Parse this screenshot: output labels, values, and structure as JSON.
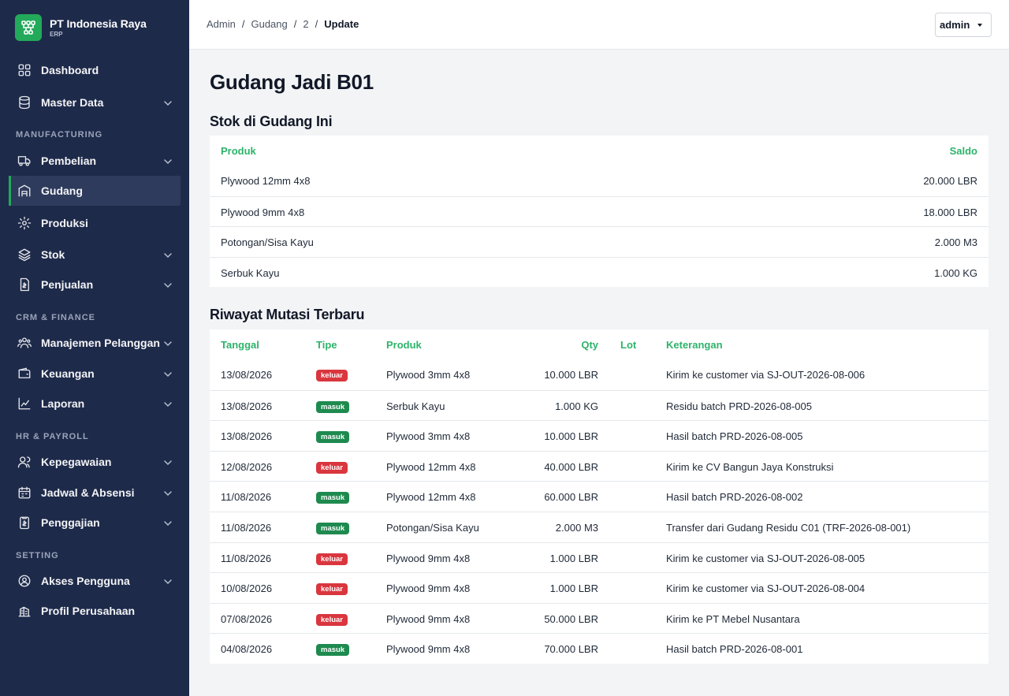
{
  "brand": {
    "name": "PT Indonesia Raya",
    "sub": "ERP",
    "logo_icon": "hierarchy-icon",
    "color": "#22a95a"
  },
  "sidebar": {
    "sections": [
      "MANUFACTURING",
      "CRM & FINANCE",
      "HR & PAYROLL",
      "SETTING"
    ],
    "items": [
      {
        "label": "Dashboard",
        "icon": "grid-icon",
        "dropdown": false
      },
      {
        "label": "Master Data",
        "icon": "database-icon",
        "dropdown": true
      },
      {
        "label": "Pembelian",
        "icon": "truck-icon",
        "dropdown": true
      },
      {
        "label": "Gudang",
        "icon": "warehouse-icon",
        "dropdown": false,
        "active": true
      },
      {
        "label": "Produksi",
        "icon": "gear-icon",
        "dropdown": false
      },
      {
        "label": "Stok",
        "icon": "layers-icon",
        "dropdown": true
      },
      {
        "label": "Penjualan",
        "icon": "invoice-icon",
        "dropdown": true
      },
      {
        "label": "Manajemen Pelanggan",
        "icon": "users-icon",
        "dropdown": true
      },
      {
        "label": "Keuangan",
        "icon": "wallet-icon",
        "dropdown": true
      },
      {
        "label": "Laporan",
        "icon": "chart-icon",
        "dropdown": true
      },
      {
        "label": "Kepegawaian",
        "icon": "people-icon",
        "dropdown": true
      },
      {
        "label": "Jadwal & Absensi",
        "icon": "calendar-icon",
        "dropdown": true
      },
      {
        "label": "Penggajian",
        "icon": "payroll-icon",
        "dropdown": true
      },
      {
        "label": "Akses Pengguna",
        "icon": "user-circle-icon",
        "dropdown": true
      },
      {
        "label": "Profil Perusahaan",
        "icon": "building-icon",
        "dropdown": false
      }
    ]
  },
  "breadcrumb": [
    "Admin",
    "Gudang",
    "2",
    "Update"
  ],
  "user": {
    "name": "admin"
  },
  "page": {
    "title": "Gudang Jadi B01",
    "stock_title": "Stok di Gudang Ini",
    "history_title": "Riwayat Mutasi Terbaru"
  },
  "stock": {
    "headers": {
      "product": "Produk",
      "balance": "Saldo"
    },
    "rows": [
      {
        "product": "Plywood 12mm 4x8",
        "balance": "20.000 LBR"
      },
      {
        "product": "Plywood 9mm 4x8",
        "balance": "18.000 LBR"
      },
      {
        "product": "Potongan/Sisa Kayu",
        "balance": "2.000 M3"
      },
      {
        "product": "Serbuk Kayu",
        "balance": "1.000 KG"
      }
    ]
  },
  "history": {
    "headers": {
      "date": "Tanggal",
      "type": "Tipe",
      "product": "Produk",
      "qty": "Qty",
      "lot": "Lot",
      "note": "Keterangan"
    },
    "rows": [
      {
        "date": "13/08/2026",
        "type": "keluar",
        "product": "Plywood 3mm 4x8",
        "qty": "10.000 LBR",
        "lot": "",
        "note": "Kirim ke customer via SJ-OUT-2026-08-006"
      },
      {
        "date": "13/08/2026",
        "type": "masuk",
        "product": "Serbuk Kayu",
        "qty": "1.000 KG",
        "lot": "",
        "note": "Residu batch PRD-2026-08-005"
      },
      {
        "date": "13/08/2026",
        "type": "masuk",
        "product": "Plywood 3mm 4x8",
        "qty": "10.000 LBR",
        "lot": "",
        "note": "Hasil batch PRD-2026-08-005"
      },
      {
        "date": "12/08/2026",
        "type": "keluar",
        "product": "Plywood 12mm 4x8",
        "qty": "40.000 LBR",
        "lot": "",
        "note": "Kirim ke CV Bangun Jaya Konstruksi"
      },
      {
        "date": "11/08/2026",
        "type": "masuk",
        "product": "Plywood 12mm 4x8",
        "qty": "60.000 LBR",
        "lot": "",
        "note": "Hasil batch PRD-2026-08-002"
      },
      {
        "date": "11/08/2026",
        "type": "masuk",
        "product": "Potongan/Sisa Kayu",
        "qty": "2.000 M3",
        "lot": "",
        "note": "Transfer dari Gudang Residu C01 (TRF-2026-08-001)"
      },
      {
        "date": "11/08/2026",
        "type": "keluar",
        "product": "Plywood 9mm 4x8",
        "qty": "1.000 LBR",
        "lot": "",
        "note": "Kirim ke customer via SJ-OUT-2026-08-005"
      },
      {
        "date": "10/08/2026",
        "type": "keluar",
        "product": "Plywood 9mm 4x8",
        "qty": "1.000 LBR",
        "lot": "",
        "note": "Kirim ke customer via SJ-OUT-2026-08-004"
      },
      {
        "date": "07/08/2026",
        "type": "keluar",
        "product": "Plywood 9mm 4x8",
        "qty": "50.000 LBR",
        "lot": "",
        "note": "Kirim ke PT Mebel Nusantara"
      },
      {
        "date": "04/08/2026",
        "type": "masuk",
        "product": "Plywood 9mm 4x8",
        "qty": "70.000 LBR",
        "lot": "",
        "note": "Hasil batch PRD-2026-08-001"
      }
    ]
  },
  "colors": {
    "sidebar": "#1e2a4a",
    "accent": "#2db36a",
    "keluar": "#d9363e",
    "masuk": "#1e8a4f"
  }
}
